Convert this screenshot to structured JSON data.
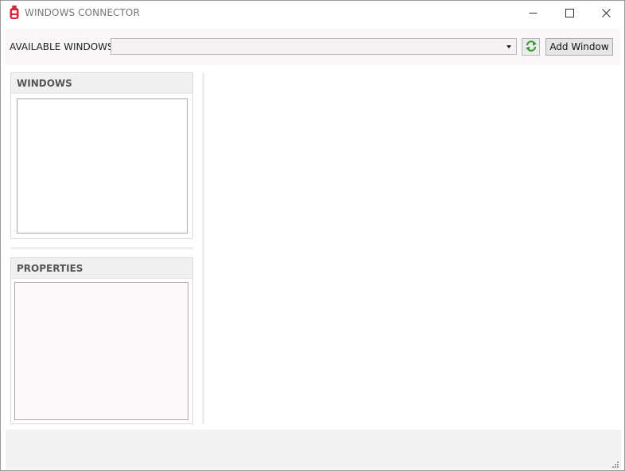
{
  "window": {
    "title": "WINDOWS CONNECTOR",
    "app_icon": "robot-icon",
    "controls": [
      "minimize-icon",
      "maximize-icon",
      "close-icon"
    ],
    "accent_color": "#c8102e"
  },
  "toolbar": {
    "available_label": "AVAILABLE WINDOWS",
    "combo_value": "",
    "refresh_icon": "refresh-icon",
    "refresh_color": "#3a9a3a",
    "add_button_label": "Add Window"
  },
  "windows_panel": {
    "title": "WINDOWS",
    "items": []
  },
  "properties_panel": {
    "title": "PROPERTIES",
    "items": []
  }
}
